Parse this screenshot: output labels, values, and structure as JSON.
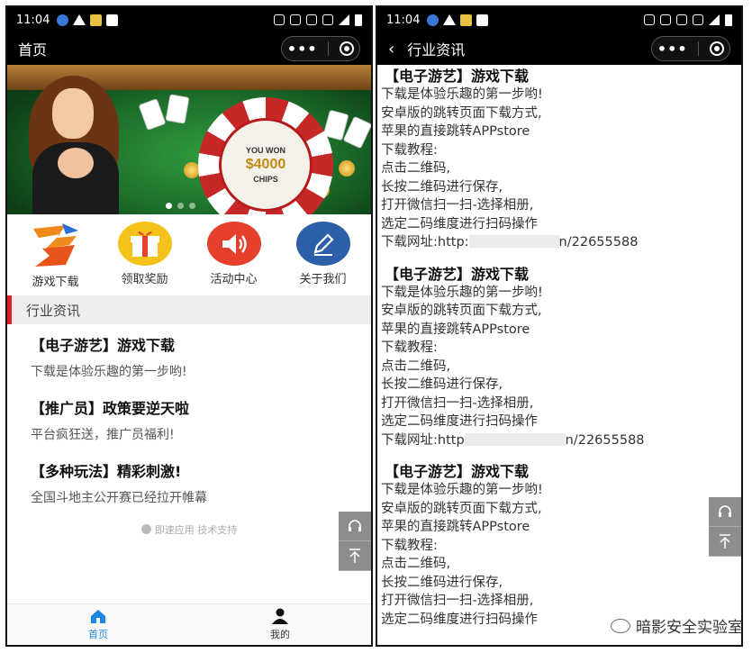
{
  "status_bar": {
    "time": "11:04"
  },
  "left": {
    "nav_title": "首页",
    "banner": {
      "chip_top": "YOU WON",
      "chip_amount": "$4000",
      "chip_bottom": "CHIPS"
    },
    "grid": [
      {
        "label": "游戏下载",
        "icon": "game-logo-icon"
      },
      {
        "label": "领取奖励",
        "icon": "gift-icon"
      },
      {
        "label": "活动中心",
        "icon": "speaker-icon"
      },
      {
        "label": "关于我们",
        "icon": "pencil-icon"
      }
    ],
    "section_title": "行业资讯",
    "news": [
      {
        "title": "【电子游艺】游戏下载",
        "desc": "下载是体验乐趣的第一步哟!"
      },
      {
        "title": "【推广员】政策要逆天啦",
        "desc": "平台疯狂送，推广员福利!"
      },
      {
        "title": "【多种玩法】精彩刺激!",
        "desc": "全国斗地主公开赛已经拉开帷幕"
      }
    ],
    "support": "即速应用 技术支持",
    "tabs": [
      {
        "label": "首页",
        "icon": "home-icon"
      },
      {
        "label": "我的",
        "icon": "user-icon"
      }
    ]
  },
  "right": {
    "nav_title": "行业资讯",
    "blocks": [
      {
        "title": "【电子游艺】游戏下载",
        "lines": [
          "下载是体验乐趣的第一步哟!",
          "安卓版的跳转页面下载方式,",
          "苹果的直接跳转APPstore",
          "下载教程:",
          "点击二维码,",
          "长按二维码进行保存,",
          "打开微信扫一扫-选择相册,",
          "选定二码维度进行扫码操作"
        ],
        "url_prefix": "下载网址:http:",
        "url_suffix": "n/22655588"
      },
      {
        "title": "【电子游艺】游戏下载",
        "lines": [
          "下载是体验乐趣的第一步哟!",
          "安卓版的跳转页面下载方式,",
          "苹果的直接跳转APPstore",
          "下载教程:",
          "点击二维码,",
          "长按二维码进行保存,",
          "打开微信扫一扫-选择相册,",
          "选定二码维度进行扫码操作"
        ],
        "url_prefix": "下载网址:http",
        "url_suffix": "n/22655588"
      },
      {
        "title": "【电子游艺】游戏下载",
        "lines": [
          "下载是体验乐趣的第一步哟!",
          "安卓版的跳转页面下载方式,",
          "苹果的直接跳转APPstore",
          "下载教程:",
          "点击二维码,",
          "长按二维码进行保存,",
          "打开微信扫一扫-选择相册,",
          "选定二码维度进行扫码操作"
        ]
      }
    ]
  },
  "watermark": "暗影安全实验室",
  "colors": {
    "accent_red": "#e02020",
    "tab_active": "#1e88e5"
  }
}
